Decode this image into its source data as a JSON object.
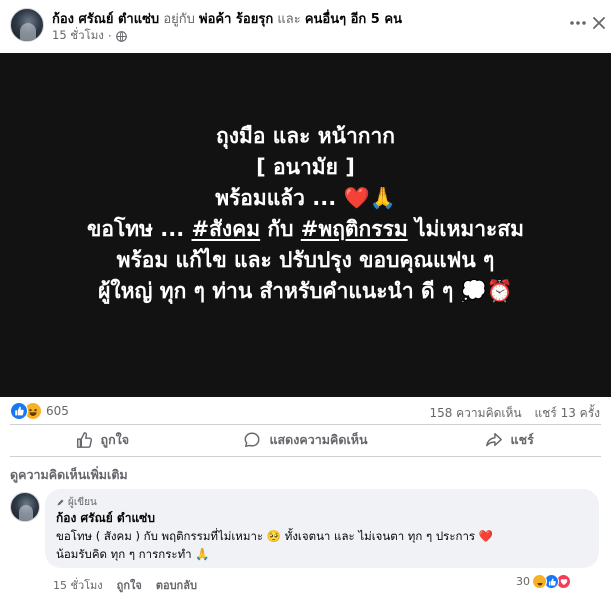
{
  "post": {
    "author": "ก้อง ศรัณย์ ตำแซ่บ",
    "with_text": "อยู่กับ",
    "tagged_name": "พ่อค้า ร้อยรุก",
    "and_text": "และ",
    "others_text": "คนอื่นๆ อีก 5 คน",
    "time": "15 ชั่วโมง",
    "lines": [
      "ถุงมือ และ หน้ากาก",
      "[ อนามัย ]",
      "พร้อมแล้ว ... ❤️🙏",
      "ขอโทษ ... ",
      "#สังคม",
      " กับ ",
      "#พฤติกรรม",
      " ไม่เหมาะสม",
      "พร้อม แก้ไข และ ปรับปรุง ขอบคุณแฟน ๆ",
      "ผู้ใหญ่ ทุก ๆ ท่าน สำหรับคำแนะนำ ดี ๆ 💭⏰"
    ],
    "background_color": "#131212"
  },
  "reactions": {
    "count": "605",
    "comments": "158 ความคิดเห็น",
    "shares": "แชร์ 13 ครั้ง",
    "icons": [
      "like-icon",
      "haha-icon"
    ]
  },
  "actions": {
    "like": "ถูกใจ",
    "comment": "แสดงความคิดเห็น",
    "share": "แชร์"
  },
  "see_more": "ดูความคิดเห็นเพิ่มเติม",
  "comment": {
    "badge": "ผู้เขียน",
    "author": "ก้อง ศรัณย์ ตำแซ่บ",
    "line1": "ขอโทษ ( สังคม ) กับ พฤติกรรมที่ไม่เหมาะ 🥺 ทั้งเจตนา และ ไม่เจนตา ทุก ๆ ประการ ❤️",
    "line2": "น้อมรับคิด ทุก ๆ การกระทำ 🙏",
    "time": "15 ชั่วโมง",
    "like": "ถูกใจ",
    "reply": "ตอบกลับ",
    "reaction_count": "30"
  },
  "colors": {
    "accent": "#1877f2",
    "muted_text": "#65676b",
    "comment_bubble": "#f0f2f5",
    "haha": "#f7b125",
    "love": "#f33e58"
  }
}
